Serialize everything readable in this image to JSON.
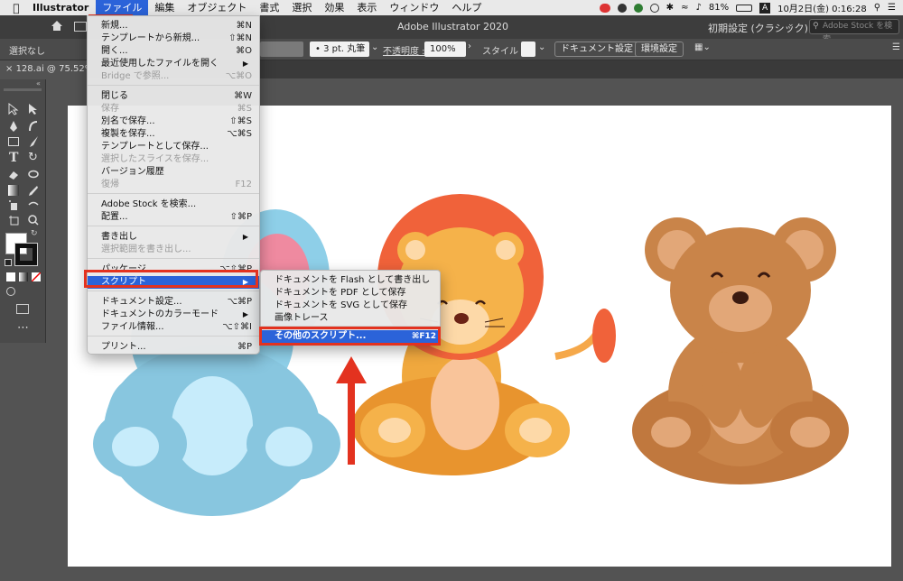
{
  "menubar": {
    "app": "Illustrator",
    "menus": [
      "ファイル",
      "編集",
      "オブジェクト",
      "書式",
      "選択",
      "効果",
      "表示",
      "ウィンドウ",
      "ヘルプ"
    ],
    "battery": "81%",
    "datetime": "10月2日(金)  0:16:28",
    "input_indicator": "A"
  },
  "titlebar": {
    "title": "Adobe Illustrator 2020",
    "workspace": "初期設定 (クラシック)",
    "search_placeholder": "Adobe Stock を検索"
  },
  "controlbar": {
    "selection": "選択なし",
    "stroke_profile": "3 pt. 丸筆",
    "opacity_label": "不透明度 :",
    "opacity_value": "100%",
    "style_label": "スタイル :",
    "doc_settings": "ドキュメント設定",
    "preferences": "環境設定"
  },
  "doc_tab": {
    "label": "128.ai @ 75.52% (R"
  },
  "file_menu": {
    "items": [
      {
        "label": "新規...",
        "shortcut": "⌘N",
        "disabled": false
      },
      {
        "label": "テンプレートから新規...",
        "shortcut": "⇧⌘N",
        "disabled": false
      },
      {
        "label": "開く...",
        "shortcut": "⌘O",
        "disabled": false
      },
      {
        "label": "最近使用したファイルを開く",
        "shortcut": "▶",
        "disabled": false
      },
      {
        "label": "Bridge で参照...",
        "shortcut": "⌥⌘O",
        "disabled": true
      },
      {
        "label": "閉じる",
        "shortcut": "⌘W",
        "disabled": false
      },
      {
        "label": "保存",
        "shortcut": "⌘S",
        "disabled": true
      },
      {
        "label": "別名で保存...",
        "shortcut": "⇧⌘S",
        "disabled": false
      },
      {
        "label": "複製を保存...",
        "shortcut": "⌥⌘S",
        "disabled": false
      },
      {
        "label": "テンプレートとして保存...",
        "shortcut": "",
        "disabled": false
      },
      {
        "label": "選択したスライスを保存...",
        "shortcut": "",
        "disabled": true
      },
      {
        "label": "バージョン履歴",
        "shortcut": "",
        "disabled": false
      },
      {
        "label": "復帰",
        "shortcut": "F12",
        "disabled": true
      },
      {
        "label": "Adobe Stock を検索...",
        "shortcut": "",
        "disabled": false
      },
      {
        "label": "配置...",
        "shortcut": "⇧⌘P",
        "disabled": false
      },
      {
        "label": "書き出し",
        "shortcut": "▶",
        "disabled": false
      },
      {
        "label": "選択範囲を書き出し...",
        "shortcut": "",
        "disabled": true
      },
      {
        "label": "パッケージ...",
        "shortcut": "⌥⇧⌘P",
        "disabled": false
      },
      {
        "label": "スクリプト",
        "shortcut": "▶",
        "disabled": false
      },
      {
        "label": "ドキュメント設定...",
        "shortcut": "⌥⌘P",
        "disabled": false
      },
      {
        "label": "ドキュメントのカラーモード",
        "shortcut": "▶",
        "disabled": false
      },
      {
        "label": "ファイル情報...",
        "shortcut": "⌥⇧⌘I",
        "disabled": false
      },
      {
        "label": "プリント...",
        "shortcut": "⌘P",
        "disabled": false
      }
    ]
  },
  "script_submenu": {
    "items": [
      {
        "label": "ドキュメントを Flash として書き出し",
        "shortcut": ""
      },
      {
        "label": "ドキュメントを PDF として保存",
        "shortcut": ""
      },
      {
        "label": "ドキュメントを SVG として保存",
        "shortcut": ""
      },
      {
        "label": "画像トレース",
        "shortcut": ""
      },
      {
        "label": "その他のスクリプト...",
        "shortcut": "⌘F12"
      }
    ]
  },
  "colors": {
    "highlight": "#2b63d9",
    "annotation_red": "#e3321f"
  }
}
